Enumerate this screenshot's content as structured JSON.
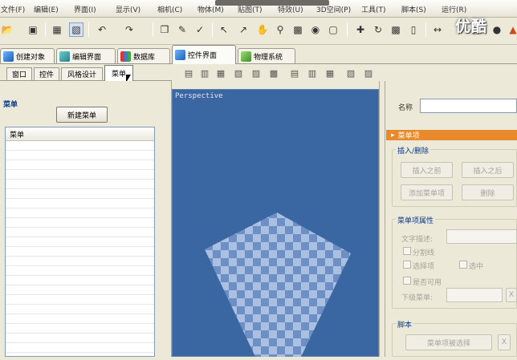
{
  "menu": {
    "items": [
      "文件(F)",
      "编辑(E)",
      "界面(I)",
      "显示(V)",
      "相机(C)",
      "物体(M)",
      "贴图(T)",
      "特效(U)",
      "3D空间(P)",
      "工具(T)",
      "脚本(S)",
      "运行(R)"
    ]
  },
  "watermark": "优酷",
  "toolbar": {
    "icons": [
      "open-icon",
      "save-icon",
      "grid-icon",
      "snap-grid-icon",
      "undo-icon",
      "redo-icon",
      "copy-icon",
      "paste-icon",
      "spell-check-icon",
      "select-pointer-icon",
      "select-move-icon",
      "hand-pan-icon",
      "zoom-icon",
      "render-icon",
      "camera-icon",
      "cube-icon",
      "move-cross-icon",
      "rotate-icon",
      "scale-icon",
      "mirror-icon",
      "align-icon",
      "shelf-icon",
      "brush-icon"
    ]
  },
  "main_tabs": [
    {
      "label": "创建对象",
      "icon": "create-object-icon"
    },
    {
      "label": "编辑界面",
      "icon": "edit-ui-icon"
    },
    {
      "label": "数据库",
      "icon": "database-icon"
    },
    {
      "label": "控件界面",
      "icon": "control-ui-icon"
    },
    {
      "label": "物理系统",
      "icon": "physics-icon"
    }
  ],
  "sub_tabs": [
    "窗口",
    "控件",
    "风格设计",
    "菜单"
  ],
  "left_panel": {
    "title": "菜单",
    "new_menu_button": "新建菜单",
    "list_header": "菜单"
  },
  "viewport": {
    "label": "Perspective"
  },
  "right_panel": {
    "name_label": "名称",
    "rollout_title": "菜单项",
    "insert_delete": {
      "title": "插入/删除",
      "insert_before": "插入之前",
      "insert_after": "插入之后",
      "add_menu_item": "添加菜单项",
      "delete": "删除"
    },
    "properties": {
      "title": "菜单项属性",
      "text_desc_label": "文字描述:",
      "separator_label": "分割线",
      "option_label": "选择项",
      "selected_label": "选中",
      "enabled_label": "是否可用",
      "submenu_label": "下级菜单:",
      "clear_label": "X"
    },
    "script": {
      "title": "脚本",
      "menu_selected_button": "菜单项被选择",
      "clear_label": "X"
    }
  },
  "colors": {
    "viewport_bg": "#3a66a2",
    "rollout_orange": "#e88a2c",
    "panel_bg": "#ece9d8"
  }
}
